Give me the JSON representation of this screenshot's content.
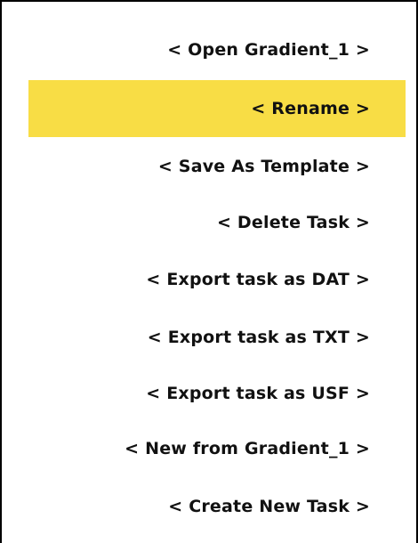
{
  "menu": {
    "selected_index": 1,
    "selected_color": "#f8dd45",
    "items": [
      {
        "label": "< Open Gradient_1 >"
      },
      {
        "label": "< Rename >"
      },
      {
        "label": "< Save As Template >"
      },
      {
        "label": "< Delete Task >"
      },
      {
        "label": "< Export task as DAT >"
      },
      {
        "label": "< Export task as TXT >"
      },
      {
        "label": "< Export task as USF >"
      },
      {
        "label": "< New from Gradient_1 >"
      },
      {
        "label": "< Create New Task >"
      }
    ]
  }
}
